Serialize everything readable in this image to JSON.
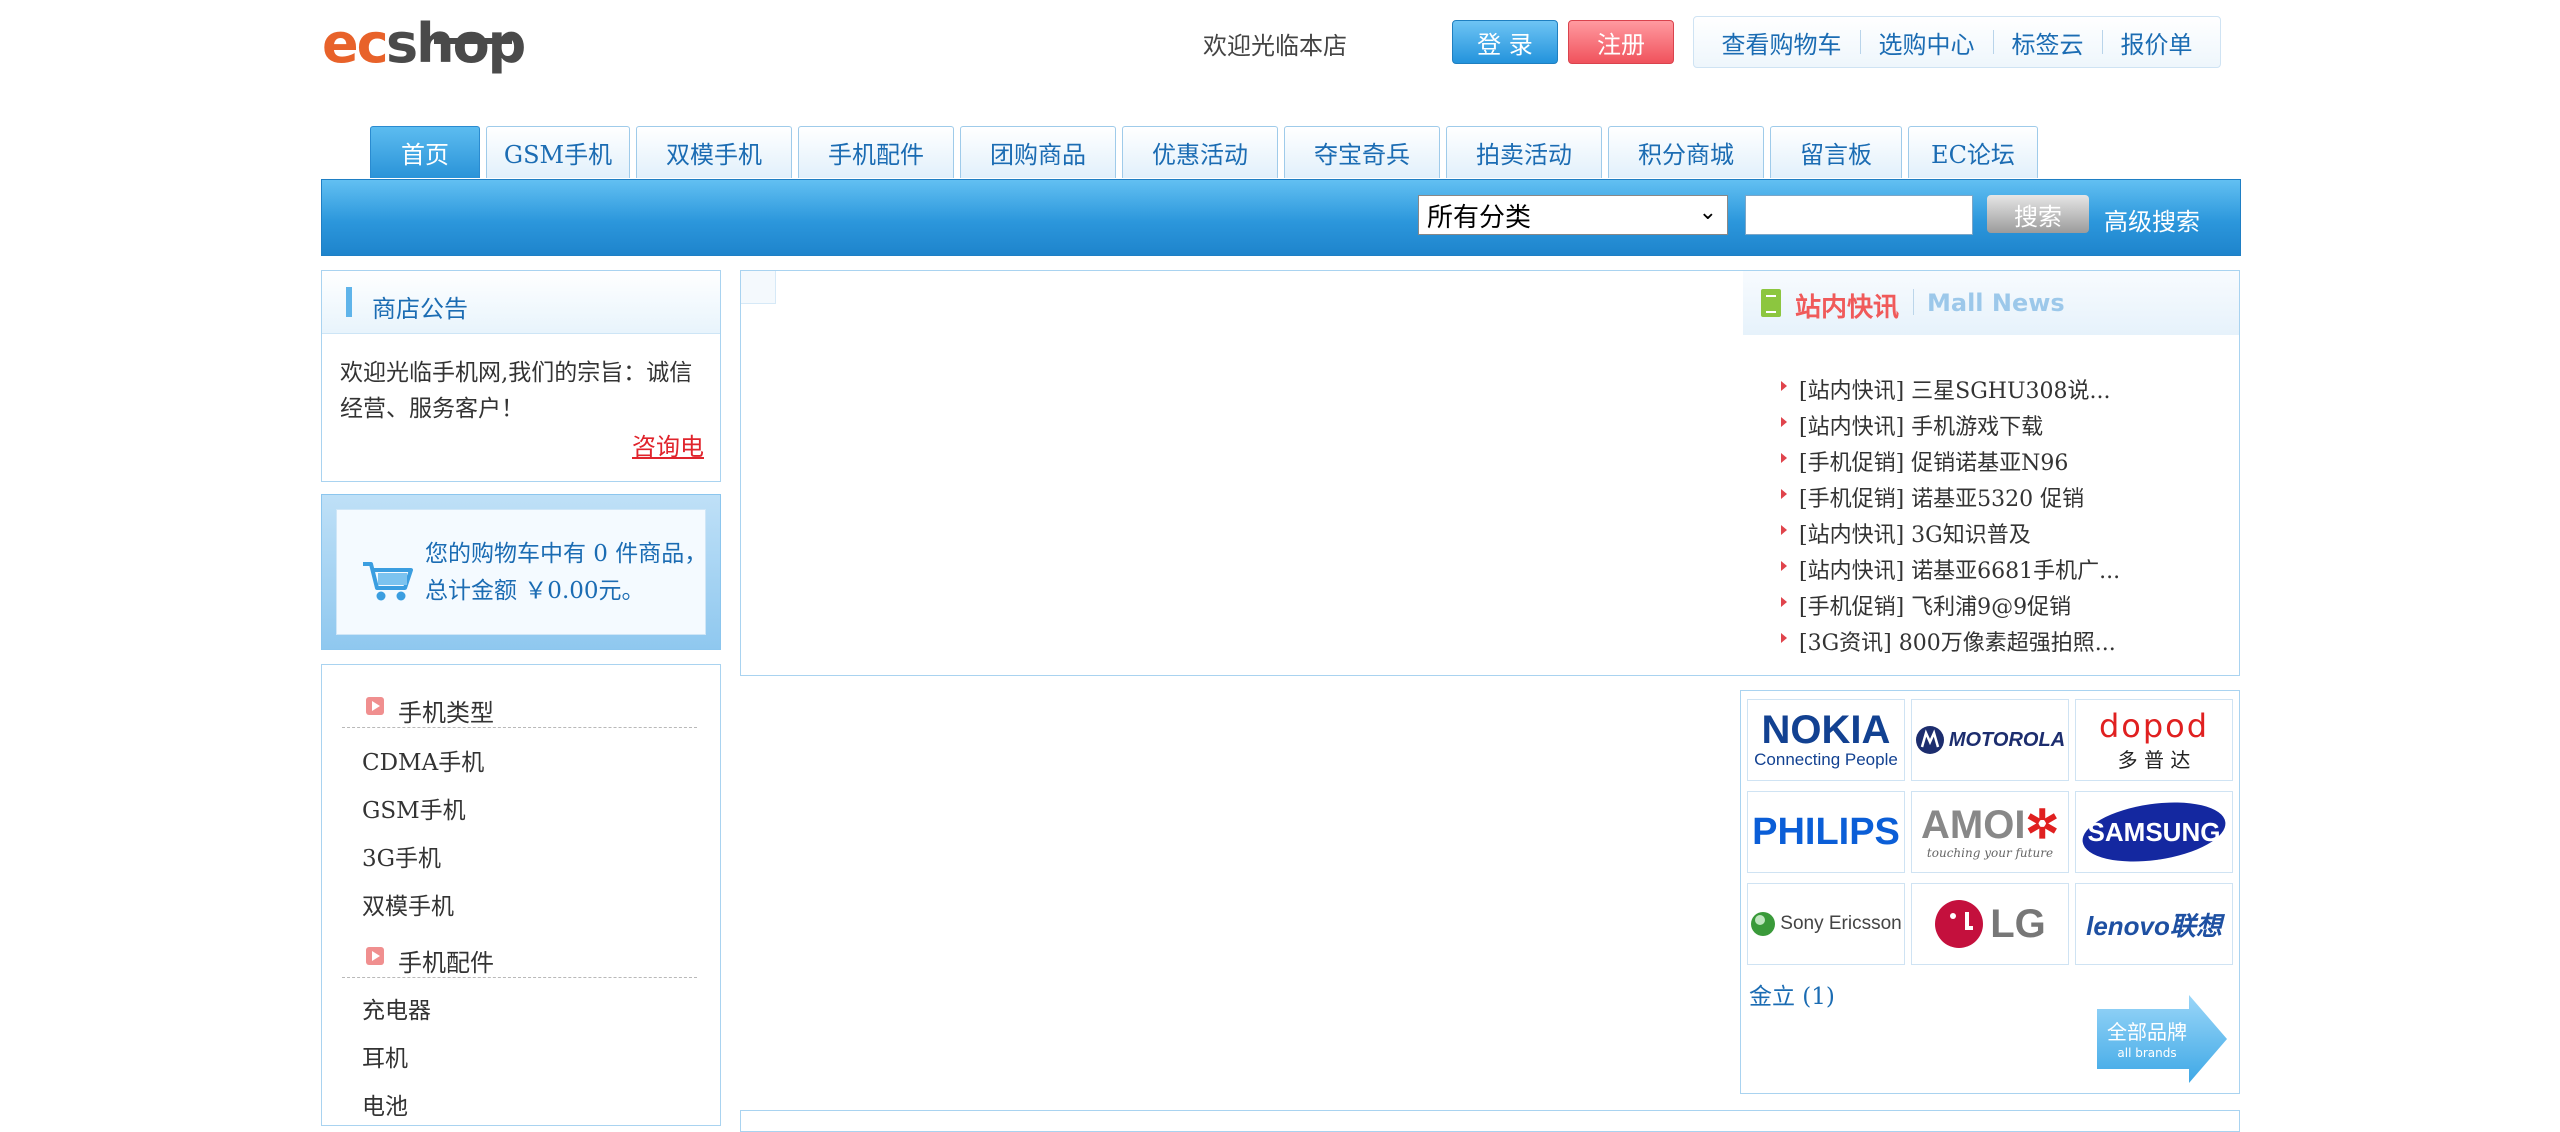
{
  "header": {
    "logo_text": "ecshop",
    "welcome": "欢迎光临本店",
    "login_label": "登 录",
    "register_label": "注册",
    "links": [
      "查看购物车",
      "选购中心",
      "标签云",
      "报价单"
    ]
  },
  "nav": {
    "tabs": [
      "首页",
      "GSM手机",
      "双模手机",
      "手机配件",
      "团购商品",
      "优惠活动",
      "夺宝奇兵",
      "拍卖活动",
      "积分商城",
      "留言板",
      "EC论坛"
    ],
    "active_index": 0
  },
  "search": {
    "category_selected": "所有分类",
    "button_label": "搜索",
    "advanced_label": "高级搜索"
  },
  "notice": {
    "title": "商店公告",
    "text": "欢迎光临手机网,我们的宗旨：诚信经营、服务客户！",
    "consult_link": "咨询电"
  },
  "cart": {
    "text": "您的购物车中有 0 件商品，总计金额 ￥0.00元。"
  },
  "categories": {
    "groups": [
      {
        "title": "手机类型",
        "items": [
          "CDMA手机",
          "GSM手机",
          "3G手机",
          "双模手机"
        ]
      },
      {
        "title": "手机配件",
        "items": [
          "充电器",
          "耳机",
          "电池"
        ]
      }
    ]
  },
  "news": {
    "title": "站内快讯",
    "title_en": "Mall News",
    "items": [
      "[站内快讯] 三星SGHU308说...",
      "[站内快讯] 手机游戏下载",
      "[手机促销] 促销诺基亚N96",
      "[手机促销] 诺基亚5320 促销",
      "[站内快讯] 3G知识普及",
      "[站内快讯] 诺基亚6681手机广...",
      "[手机促销] 飞利浦9@9促销",
      "[3G资讯] 800万像素超强拍照..."
    ]
  },
  "brands": {
    "logos": [
      {
        "name": "nokia-logo",
        "text": "NOKIA",
        "sub": "Connecting People"
      },
      {
        "name": "motorola-logo",
        "text": "MOTOROLA"
      },
      {
        "name": "dopod-logo",
        "text": "dopod",
        "sub": "多 普 达"
      },
      {
        "name": "philips-logo",
        "text": "PHILIPS"
      },
      {
        "name": "amoi-logo",
        "text": "AMOI",
        "sub": "touching your future"
      },
      {
        "name": "samsung-logo",
        "text": "SAMSUNG"
      },
      {
        "name": "sony-ericsson-logo",
        "text": "Sony Ericsson"
      },
      {
        "name": "lg-logo",
        "text": "LG"
      },
      {
        "name": "lenovo-logo",
        "text": "lenovo联想"
      }
    ],
    "link_text": "金立 (1)",
    "all_brands_label": "全部品牌",
    "all_brands_sub": "all brands"
  },
  "colors": {
    "link_blue": "#1b6cb3",
    "nav_blue": "#2c97dc",
    "news_red": "#f05a5a",
    "consult_red": "#e0242c"
  }
}
